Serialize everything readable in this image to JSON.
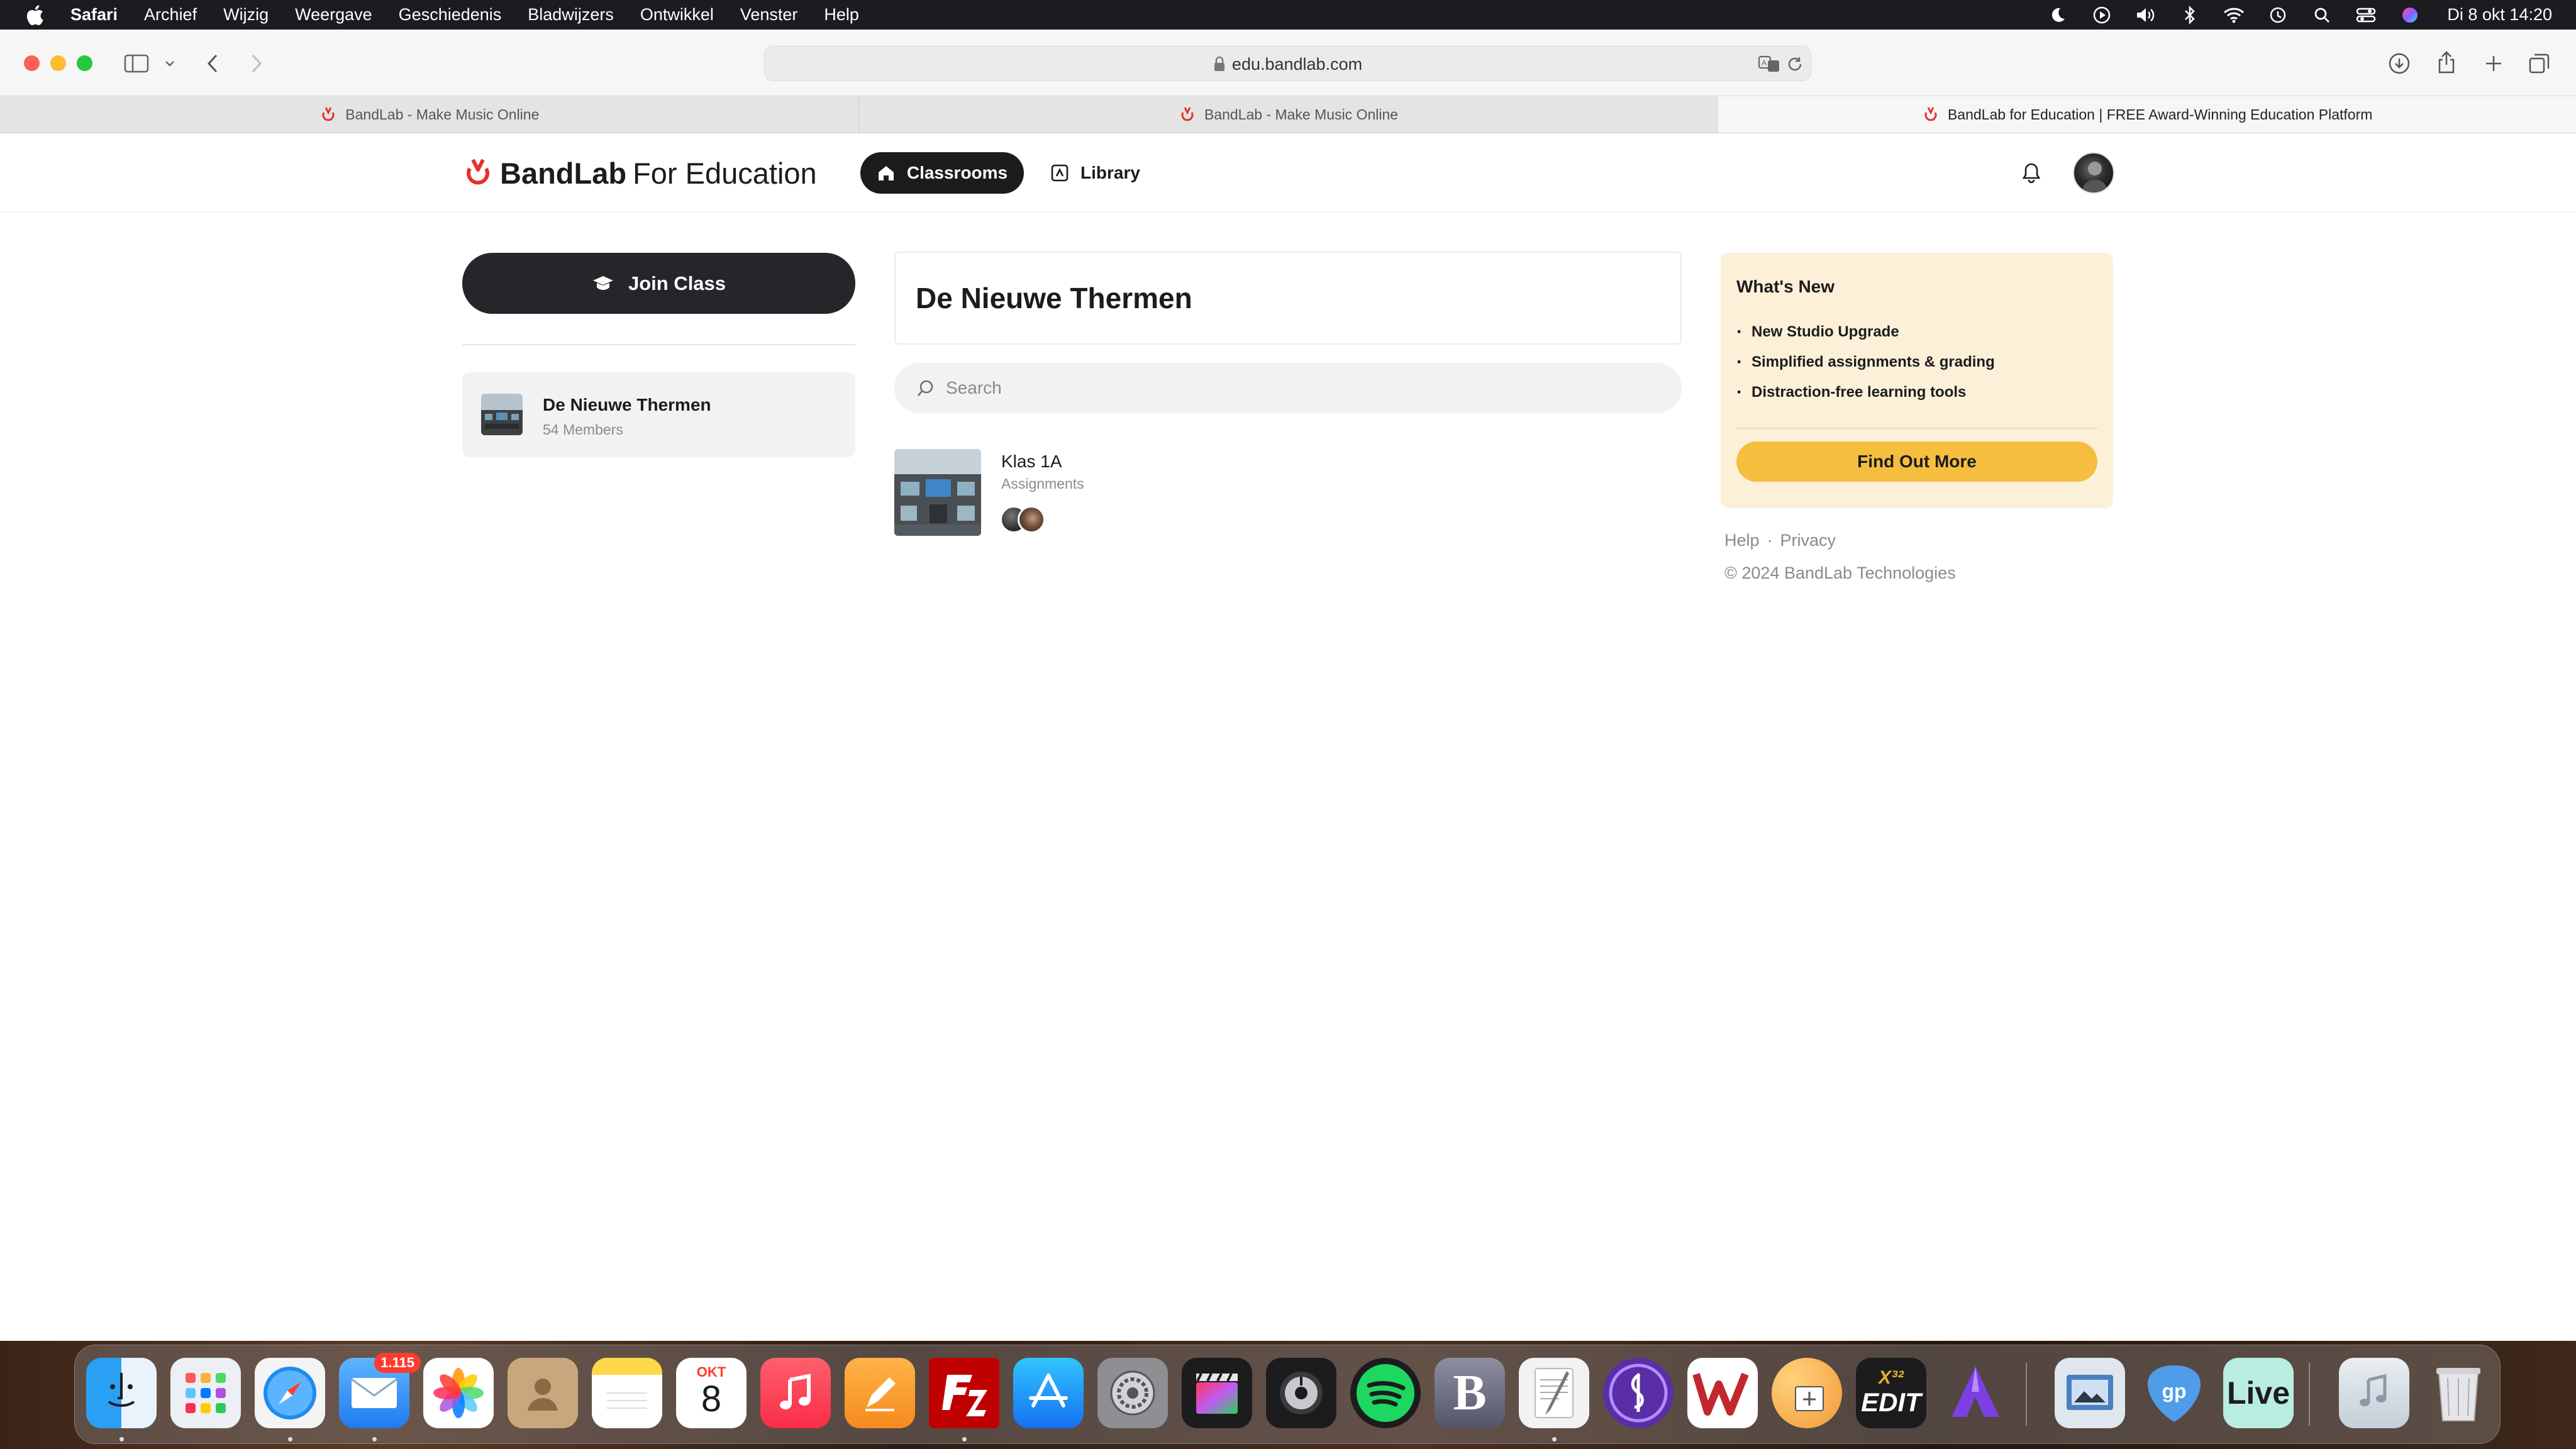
{
  "menubar": {
    "app_name": "Safari",
    "items": [
      "Archief",
      "Wijzig",
      "Weergave",
      "Geschiedenis",
      "Bladwijzers",
      "Ontwikkel",
      "Venster",
      "Help"
    ],
    "clock": "Di 8 okt  14:20"
  },
  "browser": {
    "url": "edu.bandlab.com",
    "tabs": [
      {
        "title": "BandLab - Make Music Online"
      },
      {
        "title": "BandLab - Make Music Online"
      },
      {
        "title": "BandLab for Education | FREE Award-Winning Education Platform"
      }
    ]
  },
  "header": {
    "logo_brand": "BandLab",
    "logo_suffix": "For Education",
    "nav_classrooms": "Classrooms",
    "nav_library": "Library"
  },
  "sidebar": {
    "join_label": "Join Class",
    "school": {
      "name": "De Nieuwe Thermen",
      "members": "54 Members"
    }
  },
  "main": {
    "title": "De Nieuwe Thermen",
    "search_placeholder": "Search",
    "classes": [
      {
        "name": "Klas 1A",
        "subtitle": "Assignments"
      }
    ]
  },
  "whats_new": {
    "title": "What's New",
    "items": [
      "New Studio Upgrade",
      "Simplified assignments & grading",
      "Distraction-free learning tools"
    ],
    "button": "Find Out More"
  },
  "footer": {
    "help": "Help",
    "separator": "·",
    "privacy": "Privacy",
    "copyright": "© 2024 BandLab Technologies"
  },
  "dock": {
    "mail_badge": "1.115",
    "calendar_month": "OKT",
    "calendar_day": "8",
    "app_labels": [
      "EDIT",
      "Live",
      "B"
    ]
  },
  "colors": {
    "brand_red": "#e5322d",
    "nav_dark": "#1c1c1e",
    "whats_new_bg": "#fdf0d8",
    "cta_yellow": "#f5be3f"
  }
}
